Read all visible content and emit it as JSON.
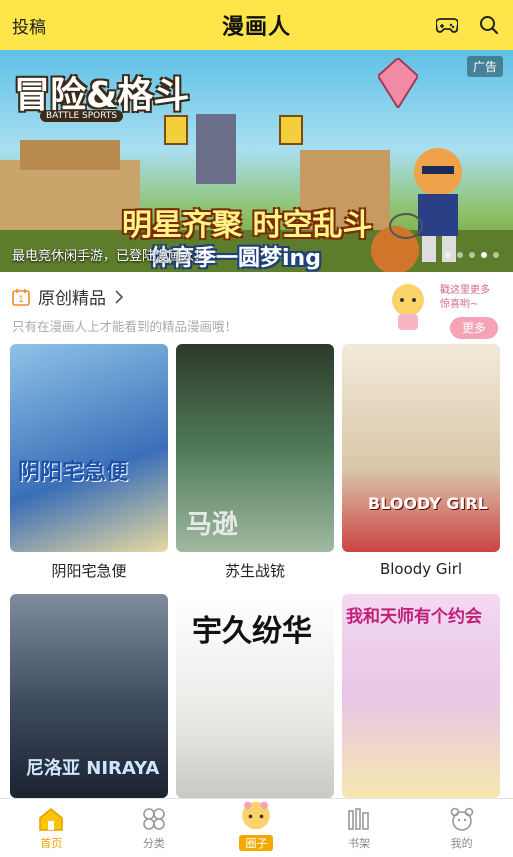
{
  "header": {
    "left_label": "投稿",
    "title": "漫画人",
    "icons": [
      "gamepad-icon",
      "search-icon"
    ]
  },
  "banner": {
    "ad_label": "广告",
    "game_title": "冒险&格斗",
    "game_subtitle": "BATTLE SPORTS",
    "headline1": "明星齐聚 时空乱斗",
    "headline2": "体育季一圆梦ing",
    "caption": "最电竞休闲手游，已登陆漫画人！",
    "slide_count": 5,
    "active_slide": 4
  },
  "section": {
    "title": "原创精品",
    "subtitle": "只有在漫画人上才能看到的精品漫画哦！",
    "bubble_line1": "戳这里更多",
    "bubble_line2": "惊喜哟~",
    "more_label": "更多",
    "date_icon_text": "1"
  },
  "comics": [
    {
      "title": "阴阳宅急便",
      "cover_text": "阴阳宅急便",
      "cover_color": "#3a6fb8"
    },
    {
      "title": "苏生战铳",
      "cover_text": "马逊",
      "cover_color": "#4f7a5a"
    },
    {
      "title": "Bloody Girl",
      "cover_text": "BLOODY GIRL",
      "cover_color": "#d9c7a9"
    },
    {
      "title": "",
      "cover_text": "尼洛亚 NIRAYA",
      "cover_color": "#3d4a5e"
    },
    {
      "title": "",
      "cover_text": "宇久纷华",
      "cover_color": "#e9e9e6"
    },
    {
      "title": "",
      "cover_text": "我和天师有个约会",
      "cover_color": "#e7c6e6"
    }
  ],
  "tabbar": {
    "tabs": [
      {
        "label": "首页",
        "icon": "home-icon"
      },
      {
        "label": "分类",
        "icon": "category-icon"
      },
      {
        "label": "圈子",
        "icon": "circle-mascot-icon"
      },
      {
        "label": "书架",
        "icon": "bookshelf-icon"
      },
      {
        "label": "我的",
        "icon": "profile-icon"
      }
    ]
  },
  "colors": {
    "header_bg": "#fde54a",
    "accent": "#f4a300",
    "more_button": "#f6a3b5"
  }
}
